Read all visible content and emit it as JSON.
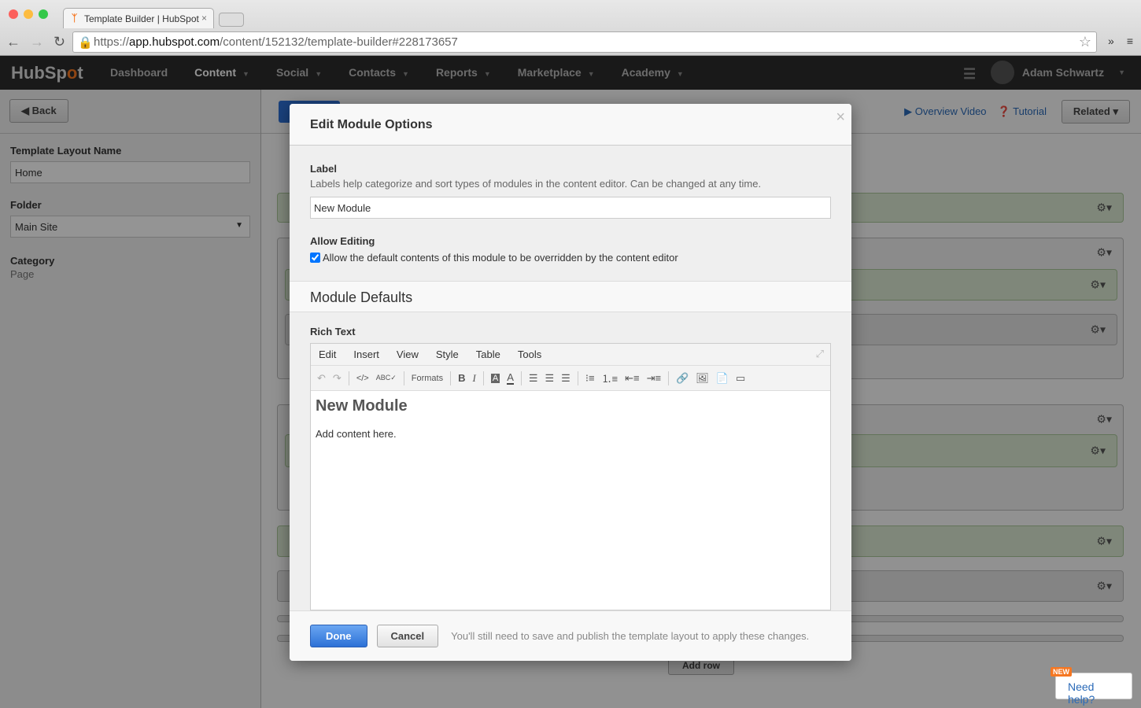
{
  "browser": {
    "tab_title": "Template Builder | HubSpot",
    "url_scheme": "https://",
    "url_host": "app.hubspot.com",
    "url_path": "/content/152132/template-builder#228173657"
  },
  "nav": {
    "logo": "HubSpot",
    "items": [
      {
        "label": "Dashboard"
      },
      {
        "label": "Content"
      },
      {
        "label": "Social"
      },
      {
        "label": "Contacts"
      },
      {
        "label": "Reports"
      },
      {
        "label": "Marketplace"
      },
      {
        "label": "Academy"
      }
    ],
    "user": "Adam Schwartz"
  },
  "sidebar": {
    "back": "Back",
    "layout_name_label": "Template Layout Name",
    "layout_name_value": "Home",
    "folder_label": "Folder",
    "folder_value": "Main Site",
    "category_label": "Category",
    "category_value": "Page"
  },
  "main": {
    "overview_video": "Overview Video",
    "tutorial": "Tutorial",
    "related": "Related",
    "add_row": "Add row"
  },
  "modal": {
    "title": "Edit Module Options",
    "label_title": "Label",
    "label_help": "Labels help categorize and sort types of modules in the content editor. Can be changed at any time.",
    "label_value": "New Module",
    "allow_title": "Allow Editing",
    "allow_text": "Allow the default contents of this module to be overridden by the content editor",
    "allow_checked": true,
    "defaults_title": "Module Defaults",
    "rich_text_label": "Rich Text",
    "editor_menu": [
      "Edit",
      "Insert",
      "View",
      "Style",
      "Table",
      "Tools"
    ],
    "formats": "Formats",
    "editor_heading": "New Module",
    "editor_body": "Add content here.",
    "done": "Done",
    "cancel": "Cancel",
    "footer_note": "You'll still need to save and publish the template layout to apply these changes."
  },
  "help": {
    "badge": "NEW",
    "label": "Need help?"
  },
  "colors": {
    "accent": "#2d71d6",
    "brand": "#f57722"
  }
}
